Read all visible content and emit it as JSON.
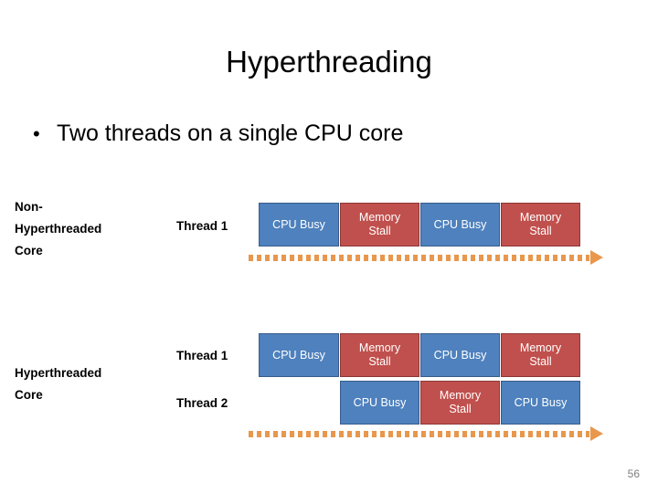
{
  "slide": {
    "title": "Hyperthreading",
    "bullet_marker": "•",
    "bullet_text": "Two threads on a single CPU core",
    "page_number": "56"
  },
  "colors": {
    "cpu_busy_fill": "#4E81BD",
    "cpu_busy_border": "#385D8A",
    "memory_stall_fill": "#C0504D",
    "memory_stall_border": "#8C3836",
    "arrow": "#E8974D",
    "text": "#000000",
    "page_number": "#808080"
  },
  "sections": [
    {
      "label": "Non-\nHyperthreaded\nCore",
      "rows": [
        {
          "thread_label": "Thread 1",
          "blocks": [
            {
              "label": "CPU Busy",
              "state": "busy"
            },
            {
              "label": "Memory\nStall",
              "state": "stall"
            },
            {
              "label": "CPU Busy",
              "state": "busy"
            },
            {
              "label": "Memory\nStall",
              "state": "stall"
            }
          ]
        }
      ],
      "timeline_arrow": true
    },
    {
      "label": "Hyperthreaded\nCore",
      "rows": [
        {
          "thread_label": "Thread 1",
          "blocks": [
            {
              "label": "CPU Busy",
              "state": "busy"
            },
            {
              "label": "Memory\nStall",
              "state": "stall"
            },
            {
              "label": "CPU Busy",
              "state": "busy"
            },
            {
              "label": "Memory\nStall",
              "state": "stall"
            }
          ]
        },
        {
          "thread_label": "Thread 2",
          "blocks": [
            {
              "label": "CPU Busy",
              "state": "busy"
            },
            {
              "label": "Memory\nStall",
              "state": "stall"
            },
            {
              "label": "CPU Busy",
              "state": "busy"
            }
          ]
        }
      ],
      "timeline_arrow": true
    }
  ]
}
